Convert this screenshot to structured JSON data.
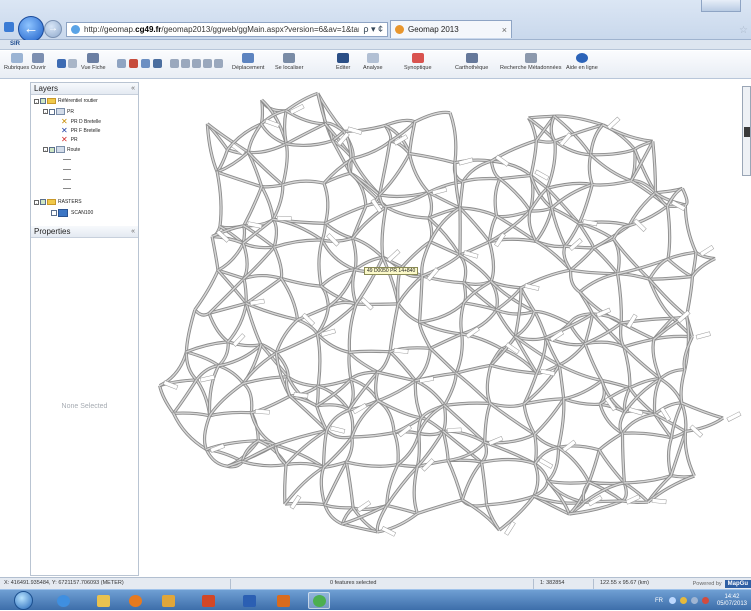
{
  "browser": {
    "url_prefix": "http://geomap.",
    "url_domain": "cg49.fr",
    "url_suffix": "/geomap2013/ggweb/ggMain.aspx?version=6&av=1&target=A",
    "addr_controls": "ρ ▾ ¢",
    "tab_title": "Geomap 2013",
    "tab_close": "×",
    "back_glyph": "←",
    "forward_glyph": "→",
    "star_glyph": "☆"
  },
  "app": {
    "name": "SIR"
  },
  "toolbar": {
    "rubriques": "Rubriques",
    "ouvrir": "Ouvrir",
    "vue_fiche": "Vue Fiche",
    "deplacement": "Déplacement",
    "se_localiser": "Se localiser",
    "editer": "Editer",
    "analyse": "Analyse",
    "synoptique": "Synoptique",
    "cartotheque": "Carthothèque",
    "recherche": "Recherche Métadonnées",
    "aide": "Aide en ligne"
  },
  "layers_panel": {
    "title": "Layers",
    "collapse": "«",
    "tree": {
      "root": "Référentiel routier",
      "pr_group": "PR",
      "pr_d": "PR D Bretelle",
      "pr_f": "PR F Bretelle",
      "pr": "PR",
      "route": "Route",
      "rasters": "RASTERS",
      "scan": "SCAN100"
    }
  },
  "properties_panel": {
    "title": "Properties",
    "collapse": "«",
    "empty_text": "None Selected"
  },
  "map": {
    "tooltip": "49 D0050 PR 14+840",
    "road_color": "#8c8c8c",
    "road_fill": "#d6d6d6"
  },
  "status": {
    "coords": "X: 416491.935484, Y: 6721157.706093 (METER)",
    "selection": "0 features selected",
    "scale": "1: 382854",
    "extent": "122.55 x 95.67 (km)",
    "powered_by": "Powered by",
    "brand": "MapGu"
  },
  "taskbar": {
    "lang": "FR",
    "time": "14:42",
    "date": "05/07/2013"
  },
  "colors": {
    "accent": "#1d5fc8",
    "taskbar": "#3d6eaa"
  }
}
